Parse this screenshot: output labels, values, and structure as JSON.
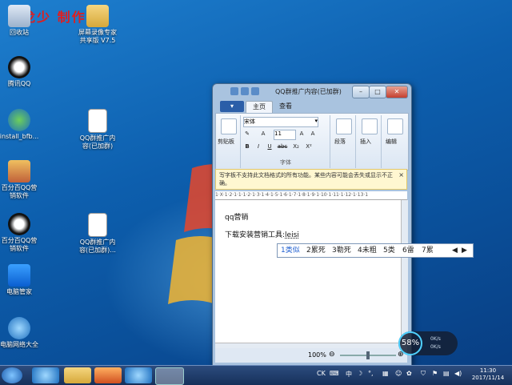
{
  "watermark": "龙少 制作",
  "desktop_icons": [
    {
      "label": "回收站",
      "name": "recycle-bin"
    },
    {
      "label": "屏幕录像专家\n共享版 V7.5",
      "name": "screen-recorder"
    },
    {
      "label": "腾讯QQ",
      "name": "tencent-qq"
    },
    {
      "label": "install_bfb...",
      "name": "install-bfb"
    },
    {
      "label": "QQ群推广内\n容(已加群)",
      "name": "docx-file-1"
    },
    {
      "label": "百分百QQ营\n销软件",
      "name": "qq-marketing-1"
    },
    {
      "label": "百分百QQ营\n销软件",
      "name": "qq-marketing-2"
    },
    {
      "label": "QQ群推广内\n容(已加群)...",
      "name": "docx-file-2"
    },
    {
      "label": "电脑管家",
      "name": "pc-manager"
    },
    {
      "label": "电脑网络大全",
      "name": "network-tools"
    }
  ],
  "window": {
    "title": "QQ群推广内容(已加群)",
    "tabs": {
      "file": "▾",
      "home": "主页",
      "view": "查看"
    },
    "ribbon": {
      "clipboard_label": "剪贴板",
      "font_name": "宋体",
      "font_size": "11",
      "font_group_label": "字体",
      "format_buttons": [
        "B",
        "I",
        "U",
        "abc",
        "X₂",
        "X²"
      ],
      "paragraph": "段落",
      "insert": "插入",
      "edit": "编辑"
    },
    "notice": "写字板不支持此文档格式的所有功能。某些内容可能会丢失或显示不正确。",
    "ruler": "1·X·1·2·1·1·1·2·1·3·1·4·1·5·1·6·1·7·1·8·1·9·1·10·1·11·1·12·1·13·1",
    "doc_line1": "qq营销",
    "doc_line2_prefix": "下载安装营销工具:",
    "doc_line2_input": "leisi",
    "zoom": "100%",
    "zoom_level": 100
  },
  "ime": {
    "candidates": [
      "1类似",
      "2累死",
      "3勒死",
      "4未粗",
      "5类",
      "6雷",
      "7累"
    ],
    "first_selected": true
  },
  "speed_widget": {
    "percent": "58%",
    "up": "0K/s",
    "down": "0K/s"
  },
  "taskbar": {
    "tray_text": "CK",
    "ime_icon": "中",
    "time": "11:30",
    "date": "2017/11/14"
  },
  "colors": {
    "accent": "#2b5ea8",
    "watermark": "#e01e1e",
    "notice_bg": "#fff7d1"
  }
}
